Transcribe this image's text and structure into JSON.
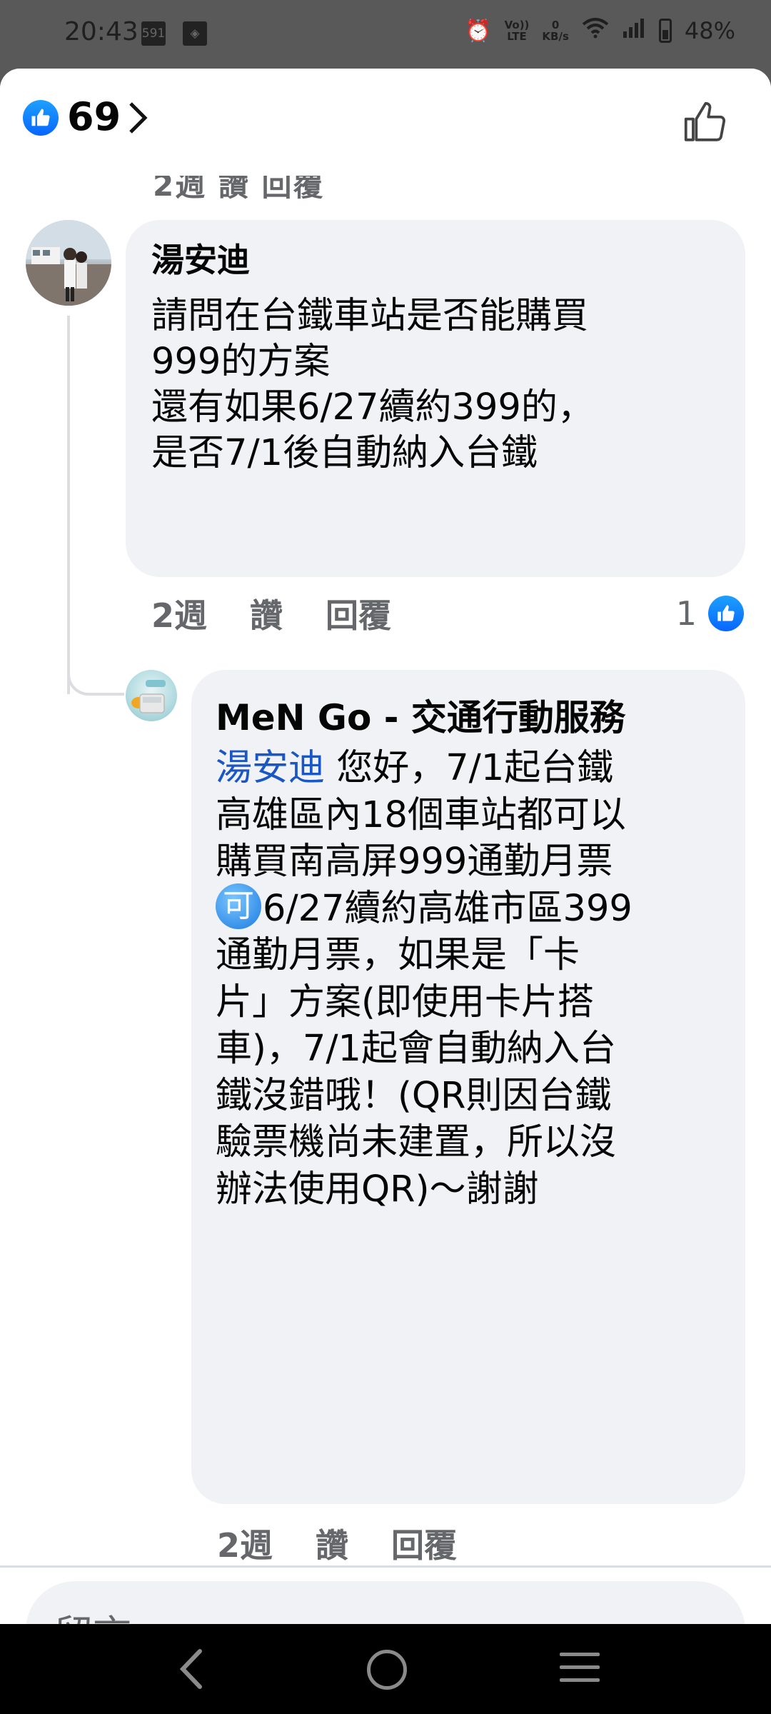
{
  "status_bar": {
    "time": "20:43",
    "badge1": "591",
    "battery": "48%",
    "net_speed_top": "0",
    "net_speed_unit": "KB/s",
    "volte_top": "Vo))",
    "volte_bottom": "LTE"
  },
  "header": {
    "like_count": "69"
  },
  "faded_actions": "2週 讚 回覆",
  "comment": {
    "author": "湯安迪",
    "lines": [
      "請問在台鐵車站是否能購買",
      "999的方案",
      "還有如果6/27續約399的，",
      "是否7/1後自動納入台鐵"
    ],
    "time": "2週",
    "like_label": "讚",
    "reply_label": "回覆",
    "reaction_count": "1"
  },
  "reply": {
    "author": "MeN Go - 交通行動服務",
    "mention": "湯安迪",
    "line1_rest": " 您好，7/1起台鐵",
    "lines": [
      "高雄區內18個車站都可以",
      "購買南高屏999通勤月票"
    ],
    "emoji_label": "可",
    "line_after_emoji": "6/27續約高雄市區399",
    "lines2": [
      "通勤月票，如果是「卡",
      "片」方案(即使用卡片搭",
      "車)，7/1起會自動納入台",
      "鐵沒錯哦！(QR則因台鐵",
      "驗票機尚未建置，所以沒",
      "辦法使用QR)～謝謝"
    ],
    "time": "2週",
    "like_label": "讚",
    "reply_label": "回覆"
  },
  "compose": {
    "placeholder": "留言……"
  },
  "colors": {
    "facebook_blue": "#0866ff",
    "mention_blue": "#1a56c4",
    "bubble_bg": "#f0f2f5",
    "meta_gray": "#65676b"
  }
}
